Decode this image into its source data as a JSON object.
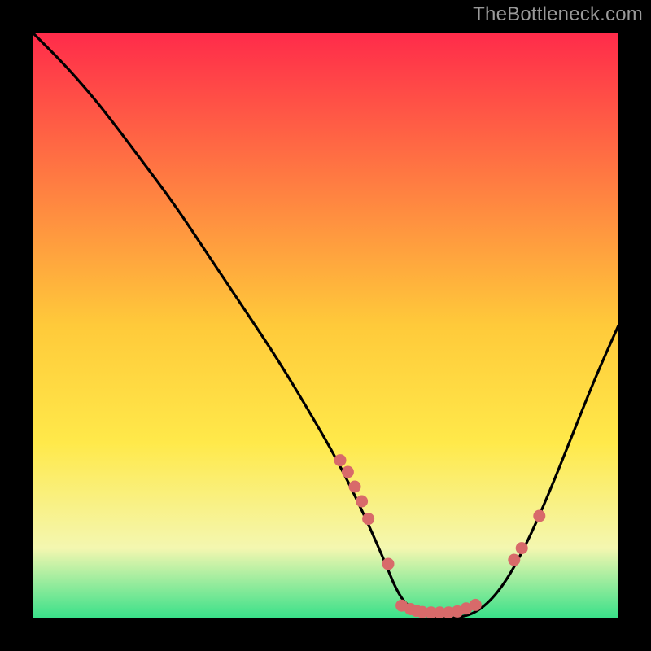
{
  "watermark": "TheBottleneck.com",
  "colors": {
    "background": "#000000",
    "curve": "#000000",
    "dot": "#d86a6a",
    "gradient_top": "#ff2b4a",
    "gradient_mid": "#ffe94a",
    "gradient_bottom": "#38e089"
  },
  "chart_data": {
    "type": "line",
    "title": "",
    "xlabel": "",
    "ylabel": "",
    "xlim": [
      0,
      100
    ],
    "ylim": [
      0,
      100
    ],
    "curve": {
      "x": [
        0,
        6,
        12,
        18,
        24,
        30,
        36,
        42,
        48,
        52,
        56,
        60,
        62,
        64,
        68,
        72,
        76,
        80,
        84,
        88,
        92,
        96,
        100
      ],
      "y": [
        100,
        94,
        87,
        79,
        71,
        62,
        53,
        44,
        34,
        27,
        19,
        10,
        5,
        2,
        0,
        0,
        1,
        5,
        12,
        21,
        31,
        41,
        50
      ]
    },
    "dots": [
      {
        "x": 52.5,
        "y": 27.0
      },
      {
        "x": 53.8,
        "y": 25.0
      },
      {
        "x": 55.0,
        "y": 22.5
      },
      {
        "x": 56.2,
        "y": 20.0
      },
      {
        "x": 57.3,
        "y": 17.0
      },
      {
        "x": 60.7,
        "y": 9.3
      },
      {
        "x": 63.0,
        "y": 2.2
      },
      {
        "x": 64.5,
        "y": 1.6
      },
      {
        "x": 65.5,
        "y": 1.3
      },
      {
        "x": 66.5,
        "y": 1.1
      },
      {
        "x": 68.0,
        "y": 1.0
      },
      {
        "x": 69.5,
        "y": 1.0
      },
      {
        "x": 71.0,
        "y": 1.0
      },
      {
        "x": 72.5,
        "y": 1.2
      },
      {
        "x": 74.0,
        "y": 1.7
      },
      {
        "x": 75.6,
        "y": 2.3
      },
      {
        "x": 82.2,
        "y": 10.0
      },
      {
        "x": 83.5,
        "y": 12.0
      },
      {
        "x": 86.5,
        "y": 17.5
      }
    ]
  }
}
